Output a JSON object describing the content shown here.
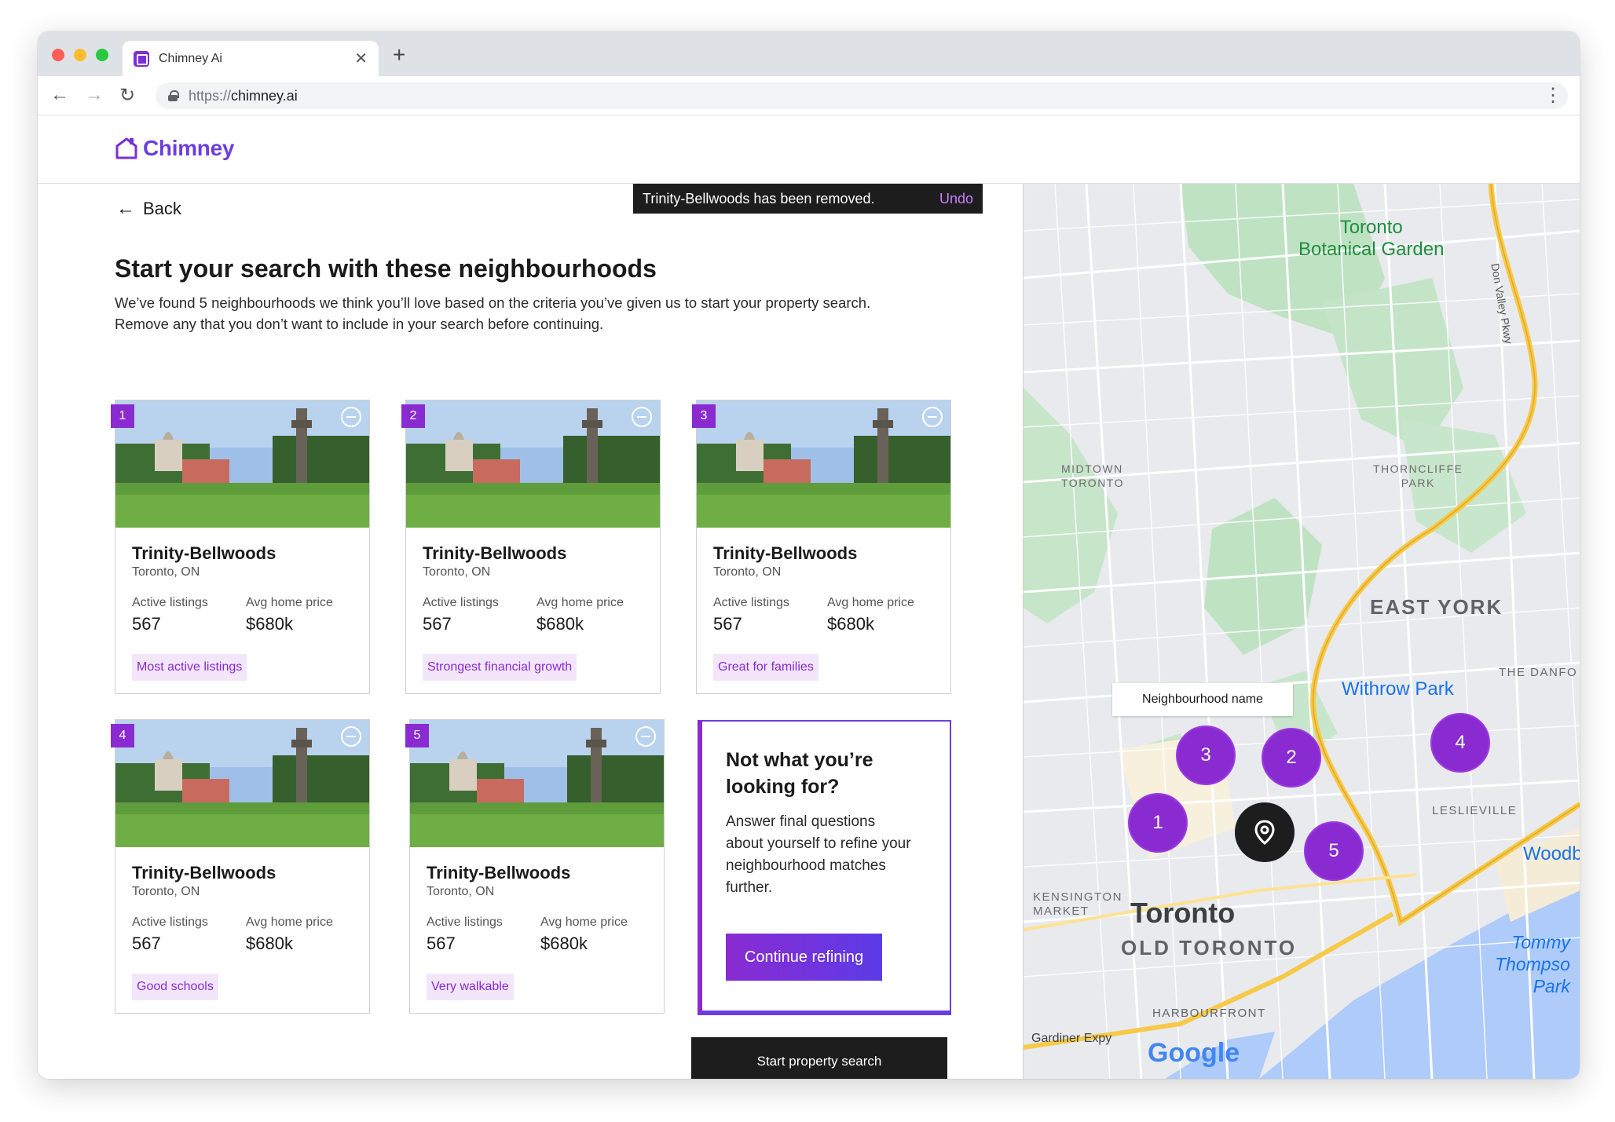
{
  "browser": {
    "tab_title": "Chimney Ai",
    "url_proto": "https://",
    "url_host": "chimney.ai"
  },
  "app": {
    "logo_text": "Chimney",
    "back_label": "Back"
  },
  "toast": {
    "message": "Trinity-Bellwoods has been removed.",
    "action": "Undo"
  },
  "page": {
    "title": "Start your search with these neighbourhoods",
    "description": "We’ve found 5 neighbourhoods we think you’ll love based on the criteria you’ve given us to start your property search. Remove any that you don’t want to include in your search before continuing."
  },
  "cards": [
    {
      "num": "1",
      "name": "Trinity-Bellwoods",
      "location": "Toronto, ON",
      "listings_label": "Active listings",
      "listings": "567",
      "price_label": "Avg home price",
      "price": "$680k",
      "tag": "Most active listings"
    },
    {
      "num": "2",
      "name": "Trinity-Bellwoods",
      "location": "Toronto, ON",
      "listings_label": "Active listings",
      "listings": "567",
      "price_label": "Avg home price",
      "price": "$680k",
      "tag": "Strongest financial growth"
    },
    {
      "num": "3",
      "name": "Trinity-Bellwoods",
      "location": "Toronto, ON",
      "listings_label": "Active listings",
      "listings": "567",
      "price_label": "Avg home price",
      "price": "$680k",
      "tag": "Great for families"
    },
    {
      "num": "4",
      "name": "Trinity-Bellwoods",
      "location": "Toronto, ON",
      "listings_label": "Active listings",
      "listings": "567",
      "price_label": "Avg home price",
      "price": "$680k",
      "tag": "Good schools"
    },
    {
      "num": "5",
      "name": "Trinity-Bellwoods",
      "location": "Toronto, ON",
      "listings_label": "Active listings",
      "listings": "567",
      "price_label": "Avg home price",
      "price": "$680k",
      "tag": "Very walkable"
    }
  ],
  "refine": {
    "title": "Not what you’re looking for?",
    "text": "Answer final questions about yourself to refine your neighbourhood matches further.",
    "button": "Continue refining"
  },
  "start_button": "Start property search",
  "map": {
    "labels": {
      "botanical_1": "Toronto",
      "botanical_2": "Botanical Garden",
      "don_valley": "Don Valley Pkwy",
      "don_valley_2": "Don Valley",
      "midtown_1": "MIDTOWN",
      "midtown_2": "TORONTO",
      "thorncliffe_1": "THORNCLIFFE",
      "thorncliffe_2": "PARK",
      "east_york": "EAST YORK",
      "danforth": "THE DANFO",
      "withrow": "Withrow Park",
      "leslieville": "LESLIEVILLE",
      "woodbine": "Woodbi",
      "kensington_1": "KENSINGTON",
      "kensington_2": "MARKET",
      "toronto": "Toronto",
      "old_toronto": "OLD TORONTO",
      "harbourfront": "HARBOURFRONT",
      "gardiner": "Gardiner Expy",
      "tommy_1": "Tommy",
      "tommy_2": "Thompso",
      "tommy_3": "Park",
      "google": "Google"
    },
    "tooltip": "Neighbourhood name",
    "pins": [
      "1",
      "2",
      "3",
      "4",
      "5"
    ]
  }
}
